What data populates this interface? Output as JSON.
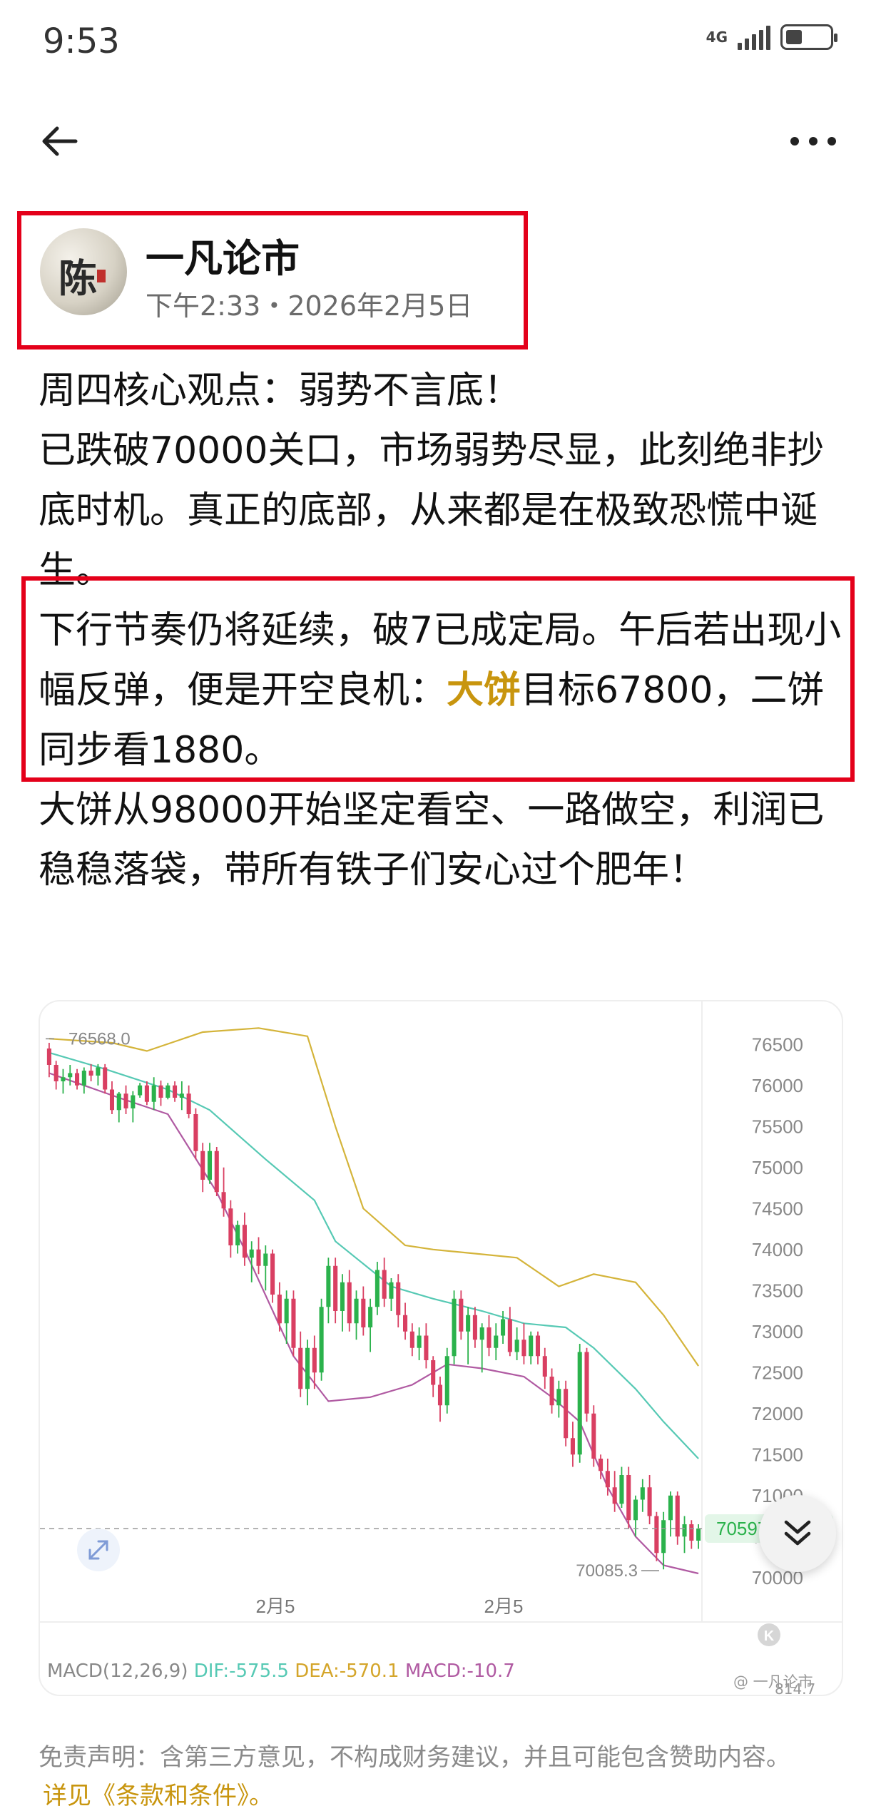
{
  "status_bar": {
    "time": "9:53",
    "network": "4G",
    "battery_level": 0.35,
    "icons": [
      "signal-icon",
      "battery-icon"
    ]
  },
  "nav": {
    "back_icon": "arrow-left-icon",
    "more_icon": "more-dots-icon"
  },
  "author": {
    "name": "一凡论市",
    "avatar_char": "陈",
    "time": "下午2:33・2026年2月5日"
  },
  "post": {
    "p1": "周四核心观点：弱势不言底！",
    "p2": "已跌破70000关口，市场弱势尽显，此刻绝非抄底时机。真正的底部，从来都是在极致恐慌中诞生。",
    "p3_pre": "下行节奏仍将延续，破7已成定局。午后若出现小幅反弹，便是开空良机：",
    "p3_hl": "大饼",
    "p3_post": "目标67800，二饼同步看1880。",
    "p4": "大饼从98000开始坚定看空、一路做空，利润已稳稳落袋，带所有铁子们安心过个肥年！",
    "highlight_color": "#c8950e",
    "box_color": "#e4001a"
  },
  "chart_data": {
    "type": "candlestick",
    "y_ticks": [
      "76500",
      "76000",
      "75500",
      "75000",
      "74500",
      "74000",
      "73500",
      "73000",
      "72500",
      "72000",
      "71500",
      "71000",
      "70500",
      "70000"
    ],
    "ylim": [
      69850,
      76850
    ],
    "x_labels": [
      "2月5",
      "2月5"
    ],
    "price_high_label": "76568.0",
    "price_low_label": "70085.3",
    "current_price_label": "70597.9",
    "current_price": 70597.9,
    "macd": {
      "name": "MACD(12,26,9)",
      "dif": "DIF:-575.5",
      "dea": "DEA:-570.1",
      "macd": "MACD:-10.7",
      "partial_value": "814.7"
    },
    "watermark": "@ 一凡论市",
    "colors": {
      "up": "#2bb24c",
      "down": "#d93f62",
      "upper_band": "#d4b43a",
      "mid_band": "#56c9b4",
      "lower_band": "#b05aa2",
      "current": "#2bb24c"
    },
    "candles": [
      [
        76450,
        76520,
        76100,
        76250
      ],
      [
        76250,
        76300,
        75950,
        76050
      ],
      [
        76050,
        76200,
        75900,
        76100
      ],
      [
        76100,
        76250,
        76000,
        76150
      ],
      [
        76150,
        76200,
        75950,
        76000
      ],
      [
        76000,
        76220,
        75900,
        76180
      ],
      [
        76180,
        76260,
        76050,
        76120
      ],
      [
        76120,
        76260,
        76000,
        76220
      ],
      [
        76220,
        76260,
        75900,
        75950
      ],
      [
        75950,
        76050,
        75650,
        75700
      ],
      [
        75700,
        75920,
        75550,
        75900
      ],
      [
        75900,
        76000,
        75650,
        75720
      ],
      [
        75720,
        75930,
        75550,
        75880
      ],
      [
        75880,
        76030,
        75850,
        76000
      ],
      [
        76000,
        76050,
        75760,
        75800
      ],
      [
        75800,
        76100,
        75700,
        76000
      ],
      [
        76000,
        76060,
        75750,
        75850
      ],
      [
        75850,
        76030,
        75830,
        76000
      ],
      [
        76000,
        76050,
        75800,
        75850
      ],
      [
        75850,
        76050,
        75700,
        75900
      ],
      [
        75900,
        76000,
        75600,
        75650
      ],
      [
        75650,
        75720,
        75100,
        75200
      ],
      [
        75200,
        75300,
        74700,
        74850
      ],
      [
        74850,
        75300,
        74800,
        75200
      ],
      [
        75200,
        75250,
        74650,
        74700
      ],
      [
        74700,
        75000,
        74400,
        74500
      ],
      [
        74500,
        74600,
        73900,
        74050
      ],
      [
        74050,
        74350,
        73950,
        74300
      ],
      [
        74300,
        74450,
        73800,
        73900
      ],
      [
        73900,
        74100,
        73600,
        74000
      ],
      [
        74000,
        74150,
        73700,
        73800
      ],
      [
        73800,
        74050,
        73500,
        73950
      ],
      [
        73950,
        74000,
        73350,
        73450
      ],
      [
        73450,
        73600,
        73000,
        73100
      ],
      [
        73100,
        73500,
        72850,
        73400
      ],
      [
        73400,
        73500,
        72700,
        72800
      ],
      [
        72800,
        73000,
        72200,
        72300
      ],
      [
        72300,
        72900,
        72100,
        72800
      ],
      [
        72800,
        72950,
        72300,
        72500
      ],
      [
        72500,
        73400,
        72400,
        73300
      ],
      [
        73300,
        73900,
        73100,
        73800
      ],
      [
        73800,
        73900,
        73100,
        73250
      ],
      [
        73250,
        73700,
        73000,
        73600
      ],
      [
        73600,
        73750,
        73000,
        73100
      ],
      [
        73100,
        73500,
        72900,
        73400
      ],
      [
        73400,
        73550,
        72950,
        73050
      ],
      [
        73050,
        73400,
        72750,
        73300
      ],
      [
        73300,
        73850,
        73200,
        73750
      ],
      [
        73750,
        73900,
        73300,
        73400
      ],
      [
        73400,
        73650,
        73250,
        73600
      ],
      [
        73600,
        73700,
        73050,
        73200
      ],
      [
        73200,
        73350,
        72900,
        73000
      ],
      [
        73000,
        73100,
        72700,
        72800
      ],
      [
        72800,
        73050,
        72650,
        72950
      ],
      [
        72950,
        73100,
        72550,
        72650
      ],
      [
        72650,
        72700,
        72200,
        72350
      ],
      [
        72350,
        72450,
        71900,
        72100
      ],
      [
        72100,
        72800,
        72000,
        72700
      ],
      [
        72700,
        73500,
        72600,
        73400
      ],
      [
        73400,
        73500,
        72900,
        73000
      ],
      [
        73000,
        73300,
        72600,
        73200
      ],
      [
        73200,
        73300,
        72800,
        72900
      ],
      [
        72900,
        73100,
        72500,
        73050
      ],
      [
        73050,
        73200,
        72700,
        72800
      ],
      [
        72800,
        73100,
        72650,
        72950
      ],
      [
        72950,
        73250,
        72850,
        73150
      ],
      [
        73150,
        73300,
        72700,
        72750
      ],
      [
        72750,
        73050,
        72650,
        72900
      ],
      [
        72900,
        73100,
        72600,
        72700
      ],
      [
        72700,
        73000,
        72600,
        72950
      ],
      [
        72950,
        73000,
        72600,
        72700
      ],
      [
        72700,
        72800,
        72300,
        72450
      ],
      [
        72450,
        72550,
        72000,
        72100
      ],
      [
        72100,
        72400,
        71950,
        72300
      ],
      [
        72300,
        72400,
        71600,
        71700
      ],
      [
        71700,
        71900,
        71350,
        71500
      ],
      [
        71500,
        72850,
        71400,
        72750
      ],
      [
        72750,
        72800,
        71900,
        72000
      ],
      [
        72000,
        72100,
        71350,
        71450
      ],
      [
        71450,
        71500,
        71200,
        71300
      ],
      [
        71300,
        71450,
        71000,
        71100
      ],
      [
        71100,
        71300,
        70800,
        70900
      ],
      [
        70900,
        71350,
        70850,
        71250
      ],
      [
        71250,
        71350,
        70600,
        70700
      ],
      [
        70700,
        71000,
        70500,
        70950
      ],
      [
        70950,
        71200,
        70800,
        71100
      ],
      [
        71100,
        71250,
        70650,
        70750
      ],
      [
        70750,
        70800,
        70200,
        70300
      ],
      [
        70300,
        70800,
        70100,
        70700
      ],
      [
        70700,
        71050,
        70500,
        71000
      ],
      [
        71000,
        71050,
        70400,
        70500
      ],
      [
        70500,
        70750,
        70300,
        70650
      ],
      [
        70650,
        70700,
        70350,
        70450
      ],
      [
        70450,
        70650,
        70350,
        70598
      ]
    ],
    "upper_band": [
      [
        0,
        76570
      ],
      [
        9,
        76520
      ],
      [
        14,
        76420
      ],
      [
        22,
        76650
      ],
      [
        30,
        76700
      ],
      [
        37,
        76600
      ],
      [
        41,
        75500
      ],
      [
        45,
        74500
      ],
      [
        51,
        74050
      ],
      [
        55,
        74000
      ],
      [
        61,
        73950
      ],
      [
        67,
        73900
      ],
      [
        73,
        73550
      ],
      [
        78,
        73700
      ],
      [
        84,
        73600
      ],
      [
        88,
        73200
      ],
      [
        93,
        72580
      ]
    ],
    "mid_band": [
      [
        0,
        76400
      ],
      [
        8,
        76200
      ],
      [
        17,
        75950
      ],
      [
        23,
        75700
      ],
      [
        31,
        75100
      ],
      [
        38,
        74600
      ],
      [
        41,
        74100
      ],
      [
        49,
        73550
      ],
      [
        55,
        73400
      ],
      [
        62,
        73250
      ],
      [
        68,
        73100
      ],
      [
        74,
        73050
      ],
      [
        78,
        72800
      ],
      [
        84,
        72300
      ],
      [
        88,
        71900
      ],
      [
        93,
        71450
      ]
    ],
    "lower_band": [
      [
        0,
        76150
      ],
      [
        10,
        75850
      ],
      [
        17,
        75650
      ],
      [
        24,
        74700
      ],
      [
        28,
        74000
      ],
      [
        35,
        72700
      ],
      [
        40,
        72150
      ],
      [
        46,
        72200
      ],
      [
        52,
        72350
      ],
      [
        57,
        72600
      ],
      [
        62,
        72550
      ],
      [
        68,
        72450
      ],
      [
        72,
        72200
      ],
      [
        76,
        71900
      ],
      [
        80,
        71100
      ],
      [
        84,
        70500
      ],
      [
        88,
        70150
      ],
      [
        93,
        70050
      ]
    ]
  },
  "disclaimer": {
    "text": "免责声明：含第三方意见，不构成财务建议，并且可能包含赞助内容。",
    "link": "详见《条款和条件》。"
  },
  "scroll_button_icon": "double-chevron-down-icon",
  "expand_icon": "expand-arrows-icon",
  "chart_logo_icon": "k-logo-icon"
}
